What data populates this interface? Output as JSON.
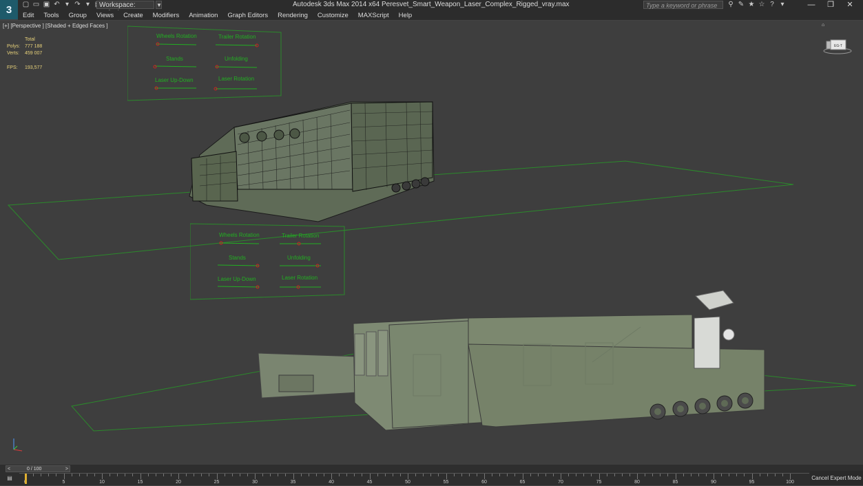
{
  "app": {
    "logo_text": "3",
    "title": "Autodesk 3ds Max  2014 x64     Peresvet_Smart_Weapon_Laser_Complex_Rigged_vray.max",
    "workspace_label": "Workspace: Default",
    "search_placeholder": "Type a keyword or phrase"
  },
  "menu": [
    "Edit",
    "Tools",
    "Group",
    "Views",
    "Create",
    "Modifiers",
    "Animation",
    "Graph Editors",
    "Rendering",
    "Customize",
    "MAXScript",
    "Help"
  ],
  "viewport": {
    "label": "[+] [Perspective ] [Shaded + Edged Faces ]",
    "stats_header": "Total",
    "polys_label": "Polys:",
    "polys_value": "777 188",
    "verts_label": "Verts:",
    "verts_value": "459 007",
    "fps_label": "FPS:",
    "fps_value": "193,577",
    "viewcube_label": "EG-T"
  },
  "rig_panels": [
    {
      "items": [
        "Wheels Rotation",
        "Trailer Rotation",
        "Stands",
        "Unfolding",
        "Laser Up-Down",
        "Laser Rotation"
      ]
    },
    {
      "items": [
        "Wheels Rotation",
        "Trailer Rotation",
        "Stands",
        "Unfolding",
        "Laser Up-Down",
        "Laser Rotation"
      ]
    }
  ],
  "timeline": {
    "frame_label": "0 / 100",
    "ticks": [
      "0",
      "5",
      "10",
      "15",
      "20",
      "25",
      "30",
      "35",
      "40",
      "45",
      "50",
      "55",
      "60",
      "65",
      "70",
      "75",
      "80",
      "85",
      "90",
      "95",
      "100"
    ]
  },
  "status": {
    "cancel_expert": "Cancel Expert Mode"
  },
  "colors": {
    "rig_text": "#22b022",
    "grid_line": "#2b8a2b",
    "stats_text": "#e8d27a",
    "model_green": "#7c8a72"
  }
}
